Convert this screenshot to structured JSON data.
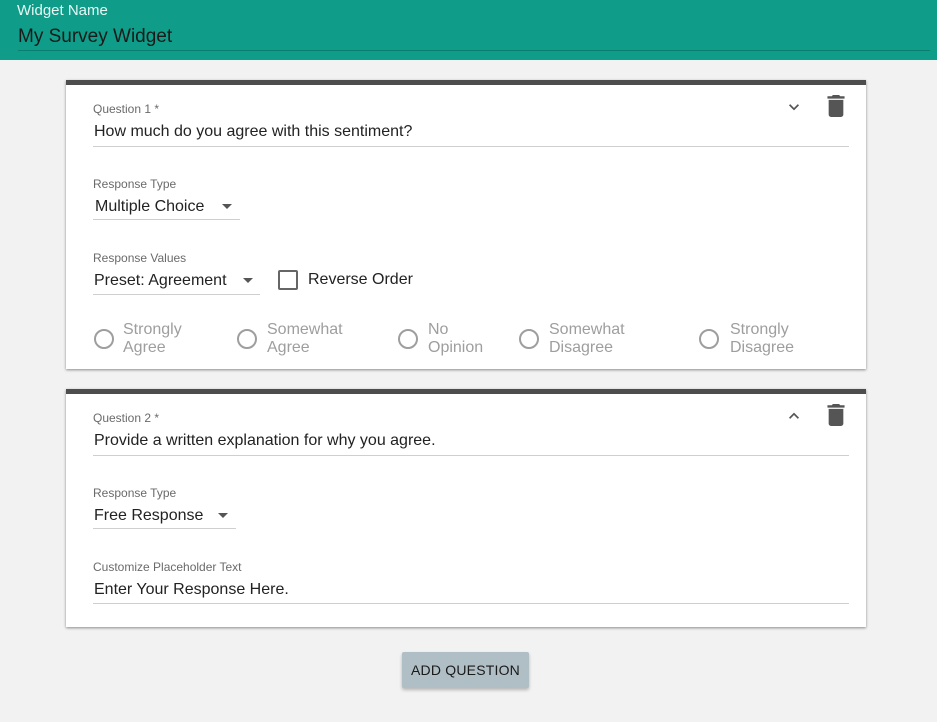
{
  "widget": {
    "name_label": "Widget Name",
    "name_value": "My Survey Widget"
  },
  "questions": [
    {
      "label": "Question 1 *",
      "text": "How much do you agree with this sentiment?",
      "response_type_label": "Response Type",
      "response_type_value": "Multiple Choice",
      "response_values_label": "Response Values",
      "response_values_value": "Preset: Agreement",
      "reverse_order_label": "Reverse Order",
      "reverse_order_checked": false,
      "options": [
        {
          "line1": "Strongly",
          "line2": "Agree"
        },
        {
          "line1": "Somewhat",
          "line2": "Agree"
        },
        {
          "line1": "No",
          "line2": "Opinion"
        },
        {
          "line1": "Somewhat",
          "line2": "Disagree"
        },
        {
          "line1": "Strongly",
          "line2": "Disagree"
        }
      ],
      "collapse_icon": "chevron-down-icon",
      "delete_icon": "trash-icon"
    },
    {
      "label": "Question 2 *",
      "text": "Provide a written explanation for why you agree.",
      "response_type_label": "Response Type",
      "response_type_value": "Free Response",
      "placeholder_label": "Customize Placeholder Text",
      "placeholder_value": "Enter Your Response Here.",
      "collapse_icon": "chevron-up-icon",
      "delete_icon": "trash-icon"
    }
  ],
  "actions": {
    "add_question": "ADD QUESTION"
  },
  "colors": {
    "header": "#0f9d89",
    "card_border": "#4d4d4d",
    "button": "#b0bec5",
    "background": "#f2f2f2"
  }
}
